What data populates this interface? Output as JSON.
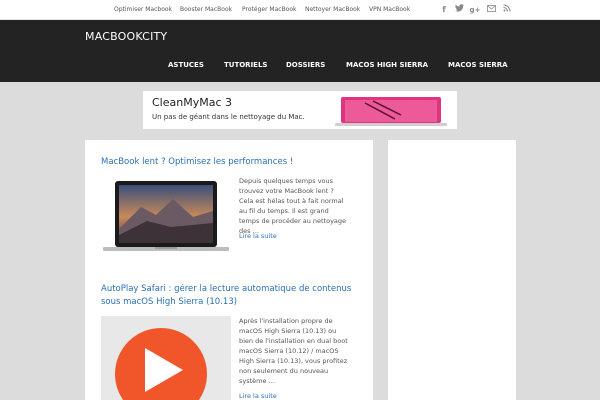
{
  "topnav": {
    "items": [
      "Optimiser Macbook",
      "Booster MacBook",
      "Protéger MacBook",
      "Nettoyer MacBook",
      "VPN MacBook"
    ]
  },
  "social": {
    "icons": [
      "facebook-icon",
      "twitter-icon",
      "google-plus-icon",
      "email-icon",
      "rss-icon"
    ]
  },
  "header": {
    "logo": "MACBOOKCITY",
    "nav": [
      "ASTUCES",
      "TUTORIELS",
      "DOSSIERS",
      "MACOS HIGH SIERRA",
      "MACOS SIERRA"
    ]
  },
  "banner": {
    "title": "CleanMyMac 3",
    "subtitle": "Un pas de géant dans le nettoyage du Mac."
  },
  "posts": [
    {
      "title": "MacBook lent ? Optimisez les performances !",
      "excerpt": "Depuis quelques temps vous trouvez votre MacBook lent ? Cela est hélas tout à fait normal au fil du temps. Il est grand temps de procéder au nettoyage des …",
      "read_more": "Lire la suite"
    },
    {
      "title": "AutoPlay Safari : gérer la lecture automatique de contenus sous macOS High Sierra (10.13)",
      "excerpt": "Après l'installation propre de macOS High Sierra (10.13) ou bien de l'installation en dual boot macOS Sierra (10.12) / macOS High Sierra (10.13), vous profitez non seulement du nouveau système …",
      "read_more": "Lire la suite"
    }
  ],
  "colors": {
    "link": "#2a6fb2",
    "header_bg": "#232323",
    "page_bg": "#dcdcdc",
    "play_orange": "#f0562a",
    "cleanmymac_pink": "#e0347e"
  }
}
